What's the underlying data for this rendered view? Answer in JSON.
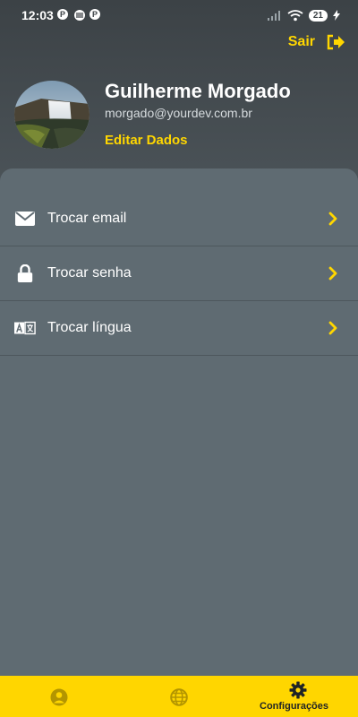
{
  "status_bar": {
    "time": "12:03",
    "app_icons": [
      "P",
      "P"
    ],
    "battery": "21"
  },
  "header": {
    "logout_label": "Sair",
    "user": {
      "name": "Guilherme Morgado",
      "email": "morgado@yourdev.com.br",
      "edit_label": "Editar Dados"
    }
  },
  "menu": {
    "items": [
      {
        "label": "Trocar email",
        "icon": "envelope-icon"
      },
      {
        "label": "Trocar senha",
        "icon": "lock-icon"
      },
      {
        "label": "Trocar língua",
        "icon": "translate-icon"
      }
    ]
  },
  "bottom_nav": {
    "items": [
      {
        "icon": "profile-icon",
        "label": ""
      },
      {
        "icon": "globe-icon",
        "label": ""
      },
      {
        "icon": "gear-icon",
        "label": "Configurações"
      }
    ]
  },
  "colors": {
    "accent": "#ffd600",
    "header_bg": "#3c4246",
    "sheet_bg": "#5f6b72",
    "divider": "#4d575d"
  }
}
